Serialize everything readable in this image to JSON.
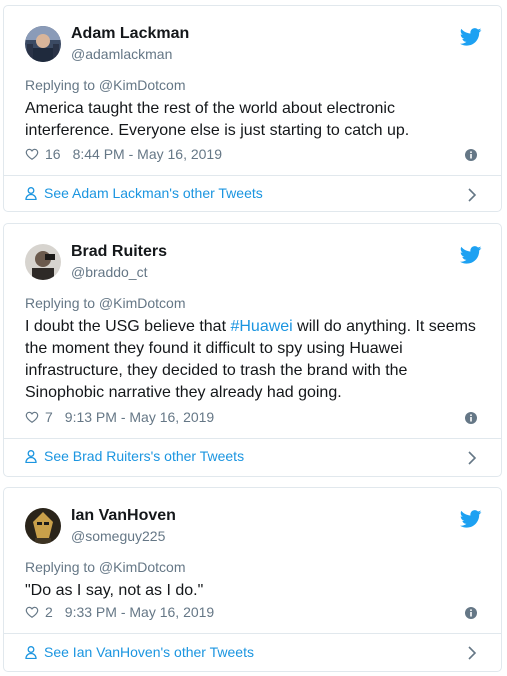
{
  "tweets": [
    {
      "name": "Adam Lackman",
      "handle": "@adamlackman",
      "replying_to": "Replying to @KimDotcom",
      "text_parts": [
        "America taught the rest of the world about electronic interference. Everyone else is just starting to catch up."
      ],
      "likes": "16",
      "timestamp": "8:44 PM - May 16, 2019",
      "footer": "See Adam Lackman's other Tweets"
    },
    {
      "name": "Brad Ruiters",
      "handle": "@braddo_ct",
      "replying_to": "Replying to @KimDotcom",
      "text_parts": [
        "I doubt the USG believe that ",
        "#Huawei",
        " will do anything. It seems the moment they found it difficult to spy using Huawei infrastructure, they decided to trash the brand with the Sinophobic narrative they already had going."
      ],
      "likes": "7",
      "timestamp": "9:13 PM - May 16, 2019",
      "footer": "See Brad Ruiters's other Tweets"
    },
    {
      "name": "Ian VanHoven",
      "handle": "@someguy225",
      "replying_to": "Replying to @KimDotcom",
      "text_parts": [
        "\"Do as I say, not as I do.\""
      ],
      "likes": "2",
      "timestamp": "9:33 PM - May 16, 2019",
      "footer": "See Ian VanHoven's other Tweets"
    }
  ],
  "icons": {
    "logo": "twitter-bird-icon",
    "like": "heart-icon",
    "info": "info-icon",
    "profile": "person-icon",
    "chevron": "chevron-right-icon"
  },
  "colors": {
    "link": "#1b95e0",
    "secondary_text": "#657786",
    "border": "#e1e8ed",
    "text": "#14171a"
  }
}
